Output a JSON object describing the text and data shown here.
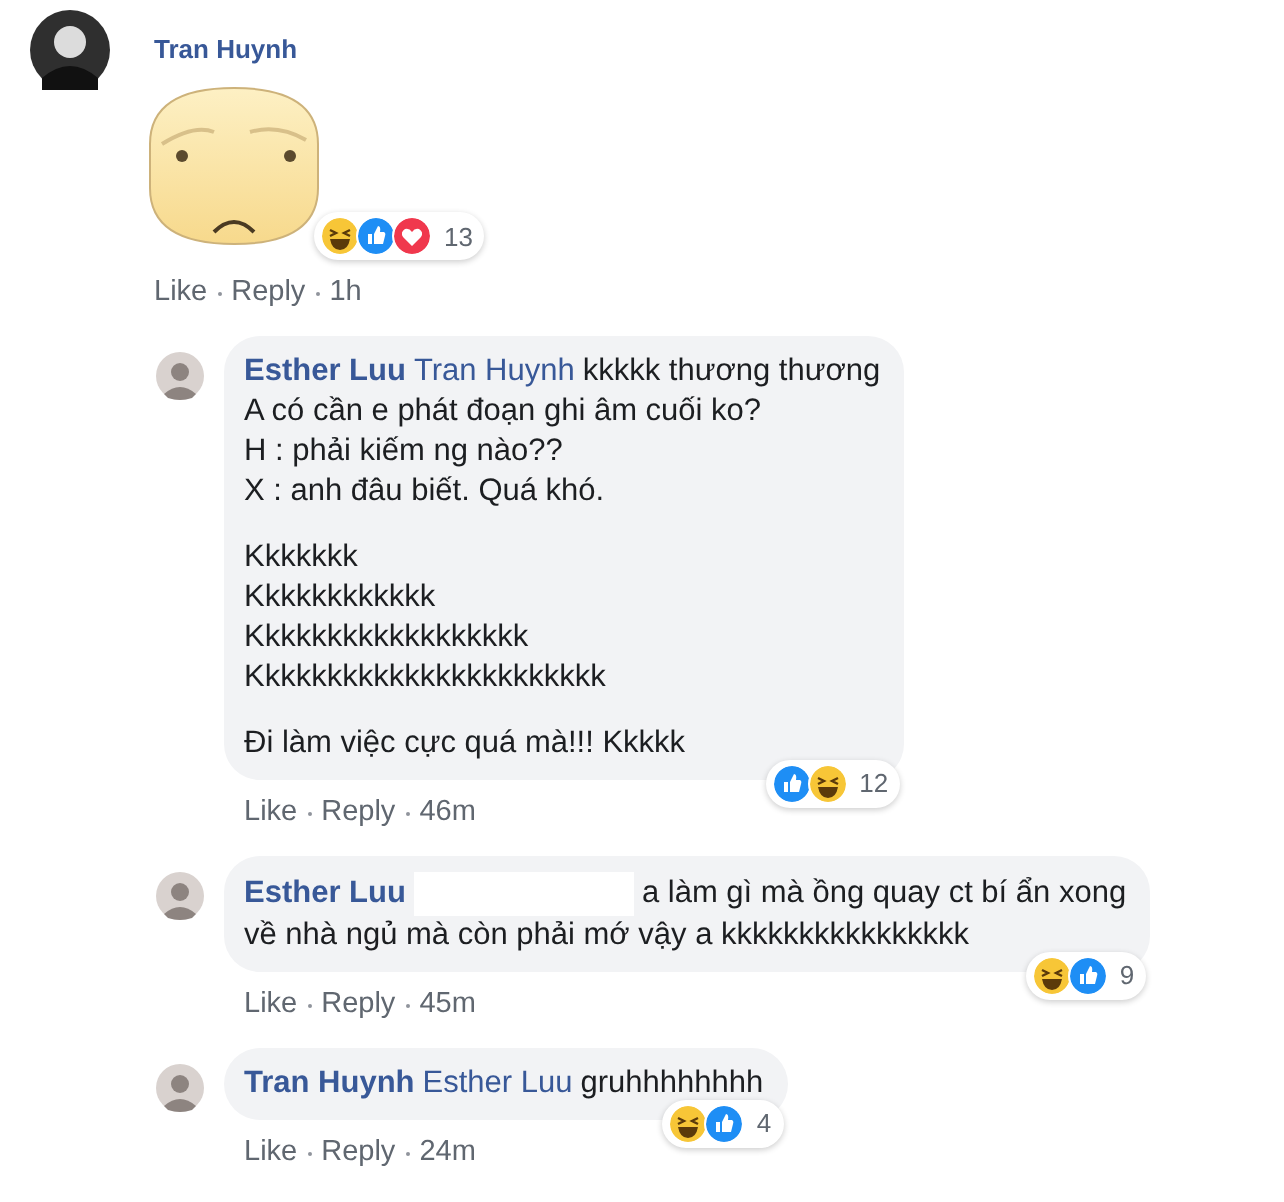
{
  "comment": {
    "author": "Tran Huynh",
    "reactions": [
      {
        "kind": "haha"
      },
      {
        "kind": "like"
      },
      {
        "kind": "love"
      }
    ],
    "reaction_count": "13",
    "actions": [
      "Like",
      "Reply"
    ],
    "time": "1h"
  },
  "replies": [
    {
      "author": "Esther Luu",
      "mention": "Tran Huynh",
      "mention_redacted": false,
      "first_line": "kkkkk thương thương",
      "paragraphs": [
        [
          "A có cần e phát đoạn ghi âm cuối ko?",
          "H : phải kiếm ng nào??",
          "X : anh đâu biết. Quá khó."
        ],
        [
          "Kkkkkkk",
          "Kkkkkkkkkkkk",
          "Kkkkkkkkkkkkkkkkkk",
          "Kkkkkkkkkkkkkkkkkkkkkkk"
        ],
        [
          "Đi làm việc cực quá mà!!! Kkkkk"
        ]
      ],
      "reactions": [
        {
          "kind": "like"
        },
        {
          "kind": "haha"
        }
      ],
      "reaction_count": "12",
      "actions": [
        "Like",
        "Reply"
      ],
      "time": "46m"
    },
    {
      "author": "Esther Luu",
      "mention_redacted": true,
      "first_line": "a làm gì mà ồng quay ct bí ẩn xong",
      "paragraphs": [
        [
          "về nhà ngủ mà còn phải mớ vậy a kkkkkkkkkkkkkkkk"
        ]
      ],
      "reactions": [
        {
          "kind": "haha"
        },
        {
          "kind": "like"
        }
      ],
      "reaction_count": "9",
      "actions": [
        "Like",
        "Reply"
      ],
      "time": "45m"
    },
    {
      "author": "Tran Huynh",
      "mention": "Esther Luu",
      "mention_redacted": false,
      "first_line": "gruhhhhhhhh",
      "reactions": [
        {
          "kind": "haha"
        },
        {
          "kind": "like"
        }
      ],
      "reaction_count": "4",
      "actions": [
        "Like",
        "Reply"
      ],
      "time": "24m"
    }
  ]
}
